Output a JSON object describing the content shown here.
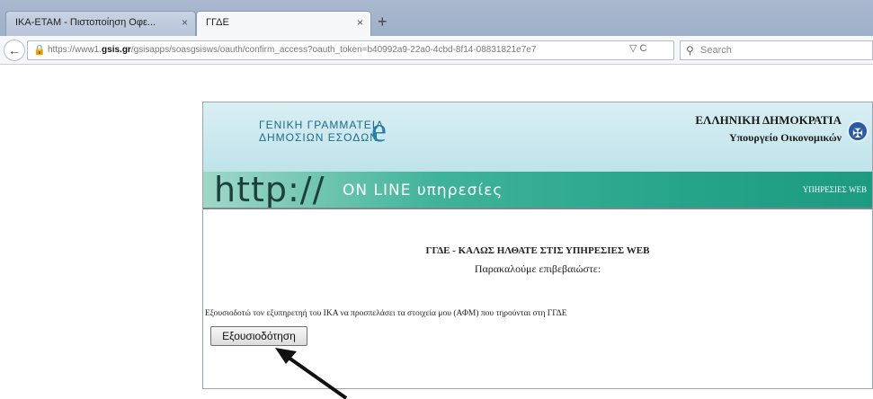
{
  "browser": {
    "tabs": [
      {
        "label": "ΙΚΑ-ΕΤΑΜ - Πιστοποίηση Οφε...",
        "close": "×"
      },
      {
        "label": "ΓΓΔΕ",
        "close": "×"
      }
    ],
    "new_tab": "+",
    "back": "←",
    "url_prefix": "https://www1.",
    "url_domain": "gsis.gr",
    "url_rest": "/gsisapps/soasgsisws/oauth/confirm_access?oauth_token=b40992a9-22a0-4cbd-8f14-08831821e7e7",
    "url_icons": "▽ C",
    "search_placeholder": "Search"
  },
  "banner": {
    "gsis_line1": "ΓΕΝΙΚΗ ΓΡΑΜΜΑΤΕΙΑ",
    "gsis_line2": "ΔΗΜΟΣΙΩΝ ΕΣΟΔΩΝ",
    "republic": "ΕΛΛΗΝΙΚΗ ΔΗΜΟΚΡΑΤΙΑ",
    "ministry": "Υπουργείο Οικονομικών",
    "http": "http://",
    "online": "ON LINE υπηρεσίες",
    "services_web": "ΥΠΗΡΕΣΙΕΣ WEB"
  },
  "content": {
    "heading": "ΓΓΔΕ - ΚΑΛΩΣ ΗΛΘΑΤΕ ΣΤΙΣ ΥΠΗΡΕΣΙΕΣ WEB",
    "subheading": "Παρακαλούμε επιβεβαιώστε:",
    "consent_text": "Εξουσιοδοτώ τον εξυπηρετηή του ΙΚΑ να προσπελάσει τα στοιχεία μου (ΑΦΜ) που τηρούνται στη ΓΓΔΕ",
    "authorize_button": "Εξουσιοδότηση"
  }
}
